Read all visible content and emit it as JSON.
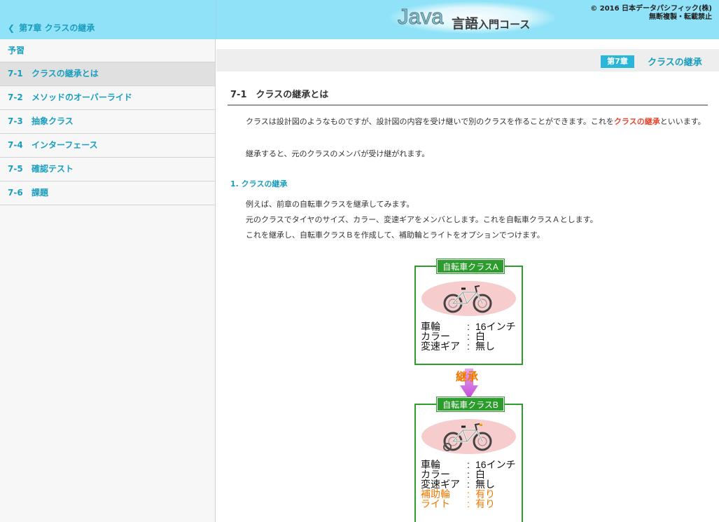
{
  "header": {
    "back_label": "第7章 クラスの継承",
    "logo_java": "Java",
    "logo_lang": "言語",
    "logo_course": "入門コース",
    "copyright_line1": "© 2016 日本データパシフィック(株)",
    "copyright_line2": "無断複製・転載禁止"
  },
  "sidebar": {
    "preview": "予習",
    "items": [
      {
        "num": "7-1",
        "label": "クラスの継承とは"
      },
      {
        "num": "7-2",
        "label": "メソッドのオーバーライド"
      },
      {
        "num": "7-3",
        "label": "抽象クラス"
      },
      {
        "num": "7-4",
        "label": "インターフェース"
      },
      {
        "num": "7-5",
        "label": "確認テスト"
      },
      {
        "num": "7-6",
        "label": "課題"
      }
    ]
  },
  "main": {
    "chapter_badge": "第7章",
    "chapter_title": "クラスの継承",
    "section_title": "7-1　クラスの継承とは",
    "p1_before": "クラスは設計図のようなものですが、設計図の内容を受け継いで別のクラスを作ることができます。これを",
    "p1_highlight": "クラスの継承",
    "p1_after": "といいます。",
    "p2": "継承すると、元のクラスのメンバが受け継がれます。",
    "sub_title": "1. クラスの継承",
    "p3": "例えば、前章の自転車クラスを継承してみます。",
    "p4": "元のクラスでタイヤのサイズ、カラー、変速ギアをメンバとします。これを自転車クラスＡとします。",
    "p5": "これを継承し、自転車クラスＢを作成して、補助輪とライトをオプションでつけます。"
  },
  "diagram": {
    "class_a": {
      "label": "自転車クラスA",
      "props": [
        {
          "key": "車輪",
          "value": "16インチ"
        },
        {
          "key": "カラー",
          "value": "白"
        },
        {
          "key": "変速ギア",
          "value": "無し"
        }
      ]
    },
    "inherit_label": "継承",
    "class_b": {
      "label": "自転車クラスB",
      "props": [
        {
          "key": "車輪",
          "value": "16インチ"
        },
        {
          "key": "カラー",
          "value": "白"
        },
        {
          "key": "変速ギア",
          "value": "無し"
        },
        {
          "key": "補助輪",
          "value": "有り"
        },
        {
          "key": "ライト",
          "value": "有り"
        }
      ]
    },
    "colors": {
      "box_border": "#2c9d2c",
      "option_text": "#f07800",
      "inherit_arrow": "#c04ad8",
      "bike_bg": "#f6cccc"
    }
  }
}
